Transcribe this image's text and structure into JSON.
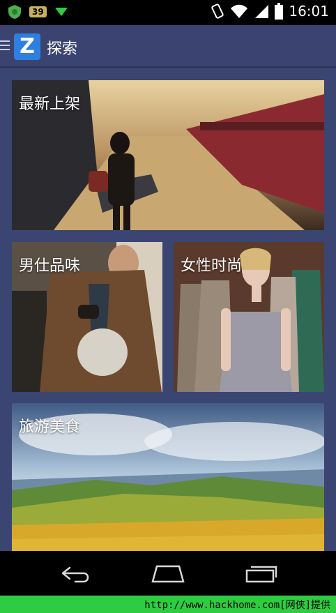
{
  "status_bar": {
    "badge": "39",
    "time": "16:01",
    "icons": [
      "shield-icon",
      "download-icon",
      "vibrate-icon",
      "wifi-icon",
      "signal-icon",
      "battery-icon"
    ]
  },
  "action_bar": {
    "logo_letter": "Z",
    "title": "探索"
  },
  "cards": [
    {
      "label": "最新上架"
    },
    {
      "label": "男仕品味"
    },
    {
      "label": "女性时尚"
    },
    {
      "label": "旅游美食"
    }
  ],
  "nav": {
    "icons": [
      "back-icon",
      "home-icon",
      "recent-apps-icon"
    ]
  },
  "watermark": {
    "text": "http://www.hackhome.com[网侠]提供"
  },
  "colors": {
    "background": "#3a4572",
    "action_bar": "#3b4470",
    "logo": "#2f7fe0",
    "watermark_bg": "#2ecc40"
  }
}
